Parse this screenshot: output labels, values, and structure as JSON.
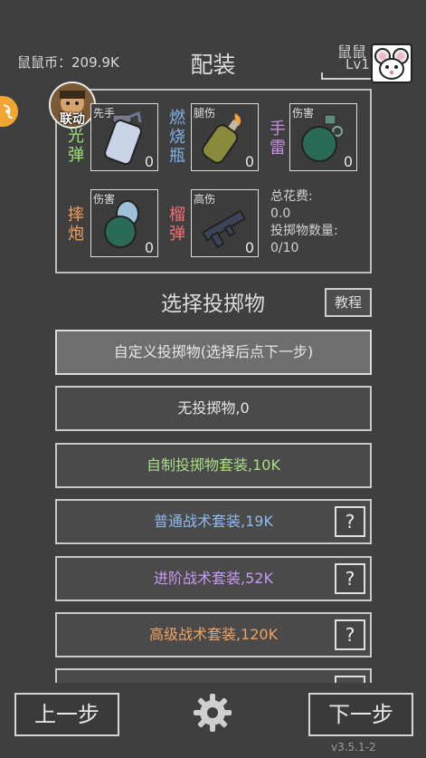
{
  "header": {
    "coin_label": "鼠鼠币：209.9K",
    "title": "配装",
    "user_name": "鼠鼠",
    "user_level": "Lv1"
  },
  "badge": {
    "text": "联动"
  },
  "slots": [
    {
      "name": "光弹",
      "tag": "先手",
      "count": "0",
      "color": "#9be07a"
    },
    {
      "name": "燃烧瓶",
      "tag": "腿伤",
      "count": "0",
      "color": "#7fb0e6"
    },
    {
      "name": "手雷",
      "tag": "伤害",
      "count": "0",
      "color": "#c48ee6"
    },
    {
      "name": "摔炮",
      "tag": "伤害",
      "count": "0",
      "color": "#f0a060"
    },
    {
      "name": "榴弹",
      "tag": "高伤",
      "count": "0",
      "color": "#f07070"
    }
  ],
  "summary": {
    "cost_label": "总花费:",
    "cost_value": "0.0",
    "count_label": "投掷物数量:",
    "count_value": "0/10"
  },
  "section": {
    "title": "选择投掷物",
    "tutorial": "教程"
  },
  "options": [
    {
      "label": "自定义投掷物(选择后点下一步)",
      "color": "#e6e6e6"
    },
    {
      "label": "无投掷物,0",
      "color": "#e6e6e6"
    },
    {
      "label": "自制投掷物套装,10K",
      "color": "#a8df86"
    },
    {
      "label": "普通战术套装,19K",
      "color": "#8fb9ec"
    },
    {
      "label": "进阶战术套装,52K",
      "color": "#c79af0"
    },
    {
      "label": "高级战术套装,120K",
      "color": "#f0a262"
    }
  ],
  "help_label": "?",
  "footer": {
    "prev": "上一步",
    "next": "下一步",
    "version": "v3.5.1-2"
  }
}
